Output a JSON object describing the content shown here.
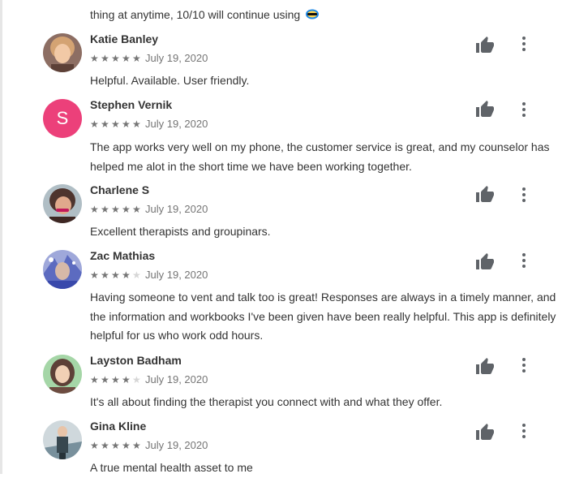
{
  "top_fragment": "thing at anytime, 10/10 will continue using",
  "reviews": [
    {
      "name": "Katie Banley",
      "rating": 5,
      "date": "July 19, 2020",
      "text": "Helpful. Available. User friendly.",
      "avatar_letter": ""
    },
    {
      "name": "Stephen Vernik",
      "rating": 5,
      "date": "July 19, 2020",
      "text": "The app works very well on my phone, the customer service is great, and my counselor has helped me alot in the short time we have been working together.",
      "avatar_letter": "S"
    },
    {
      "name": "Charlene S",
      "rating": 5,
      "date": "July 19, 2020",
      "text": "Excellent therapists and groupinars.",
      "avatar_letter": ""
    },
    {
      "name": "Zac Mathias",
      "rating": 4,
      "date": "July 19, 2020",
      "text": "Having someone to vent and talk too is great! Responses are always in a timely manner, and the information and workbooks I've been given have been really helpful. This app is definitely helpful for us who work odd hours.",
      "avatar_letter": ""
    },
    {
      "name": "Layston Badham",
      "rating": 4,
      "date": "July 19, 2020",
      "text": "It's all about finding the therapist you connect with and what they offer.",
      "avatar_letter": ""
    },
    {
      "name": "Gina Kline",
      "rating": 5,
      "date": "July 19, 2020",
      "text": "A true mental health asset to me",
      "avatar_letter": ""
    }
  ],
  "colors": {
    "avatar_s": "#ec407a",
    "star_on": "#757575",
    "star_off": "#d6d6d6",
    "icon": "#5f6368"
  },
  "icons": {
    "helpful": "thumb-up-icon",
    "menu": "more-vert-icon"
  }
}
